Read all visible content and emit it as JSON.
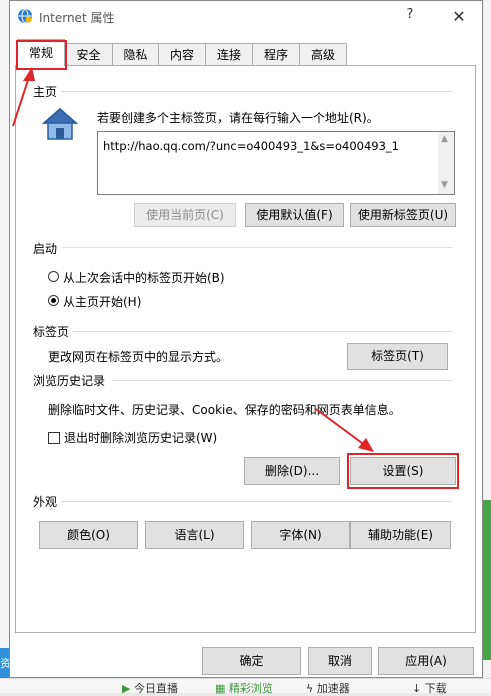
{
  "window": {
    "title": "Internet 属性"
  },
  "tabs": [
    {
      "label": "常规",
      "active": true
    },
    {
      "label": "安全"
    },
    {
      "label": "隐私"
    },
    {
      "label": "内容"
    },
    {
      "label": "连接"
    },
    {
      "label": "程序"
    },
    {
      "label": "高级"
    }
  ],
  "homepage": {
    "header": "主页",
    "instruction": "若要创建多个主标签页，请在每行输入一个地址(R)。",
    "url": "http://hao.qq.com/?unc=o400493_1&s=o400493_1",
    "buttons": {
      "use_current": "使用当前页(C)",
      "use_default": "使用默认值(F)",
      "use_new_tab": "使用新标签页(U)"
    }
  },
  "startup": {
    "header": "启动",
    "option_last_session": "从上次会话中的标签页开始(B)",
    "option_home": "从主页开始(H)",
    "selected": "option_home"
  },
  "tabs_section": {
    "header": "标签页",
    "description": "更改网页在标签页中的显示方式。",
    "button": "标签页(T)"
  },
  "history": {
    "header": "浏览历史记录",
    "description": "删除临时文件、历史记录、Cookie、保存的密码和网页表单信息。",
    "delete_on_exit": "退出时删除浏览历史记录(W)",
    "delete_on_exit_checked": false,
    "delete_button": "删除(D)...",
    "settings_button": "设置(S)"
  },
  "appearance": {
    "header": "外观",
    "buttons": {
      "colors": "颜色(O)",
      "languages": "语言(L)",
      "fonts": "字体(N)",
      "accessibility": "辅助功能(E)"
    }
  },
  "footer": {
    "ok": "确定",
    "cancel": "取消",
    "apply": "应用(A)"
  },
  "background": {
    "left_edge_text": "资",
    "bottom_items": [
      "今日直播",
      "精彩浏览",
      "加速器",
      "下载"
    ]
  },
  "colors": {
    "annotation_red": "#e0252a",
    "ie_blue": "#1f6fc8"
  }
}
